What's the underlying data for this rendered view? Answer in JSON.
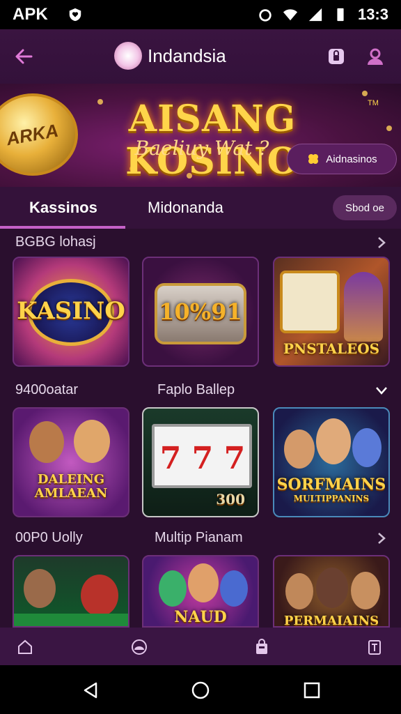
{
  "status_bar": {
    "carrier": "APK",
    "time": "13:3"
  },
  "header": {
    "title": "Indandsia"
  },
  "banner": {
    "coin_text": "ARKA",
    "title": "AISANG KOSINO",
    "tm": "TM",
    "subtitle": "Baeliuy Wat ?",
    "promo_label": "Aidnasinos"
  },
  "tabs": {
    "items": [
      {
        "label": "Kassinos",
        "active": true
      },
      {
        "label": "Midonanda",
        "active": false
      }
    ],
    "pill_label": "Sbod oe"
  },
  "sections": [
    {
      "label": "BGBG lohasj",
      "label2": "",
      "games": [
        {
          "title": "KASINO",
          "badge": ""
        },
        {
          "title": "10%91",
          "badge": ""
        },
        {
          "title": "PNSTALEOS",
          "badge": ""
        }
      ]
    },
    {
      "label": "9400oatar",
      "label2": "Faplo Ballep",
      "games": [
        {
          "title": "DALEING AMLAEAN",
          "badge": ""
        },
        {
          "title": "300",
          "badge": ""
        },
        {
          "title": "SORFMAINS",
          "subtitle": "MULTIPPANINS",
          "badge": ""
        }
      ]
    },
    {
      "label": "00P0 Uolly",
      "label2": "Multip Pianam",
      "games": [
        {
          "title": "",
          "badge": ""
        },
        {
          "title": "NAUD PIAINS",
          "badge": ""
        },
        {
          "title": "PERMAIAINS",
          "badge": ""
        }
      ]
    }
  ],
  "colors": {
    "background": "#2a0f2e",
    "accent": "#c561c8",
    "gold": "#ffd34a"
  }
}
